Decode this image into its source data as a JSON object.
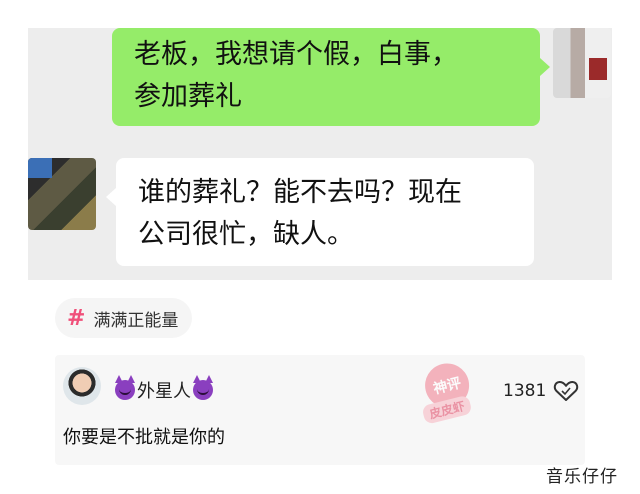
{
  "chat": {
    "outgoing_line1": "老板，我想请个假，白事，",
    "outgoing_line2": "参加葬礼",
    "incoming_line1": "谁的葬礼？能不去吗？现在",
    "incoming_line2": "公司很忙，缺人。"
  },
  "tag": {
    "icon": "#",
    "label": "满满正能量"
  },
  "comment": {
    "username": "外星人",
    "username_decoration_icon": "devil-emoji-icon",
    "stamp_top": "神评",
    "stamp_bottom": "皮皮虾",
    "likes": "1381",
    "text": "你要是不批就是你的"
  },
  "watermark": "音乐仔仔",
  "colors": {
    "outgoing_bubble": "#95ec69",
    "chat_bg": "#ededed",
    "tag_accent": "#f0507a"
  }
}
